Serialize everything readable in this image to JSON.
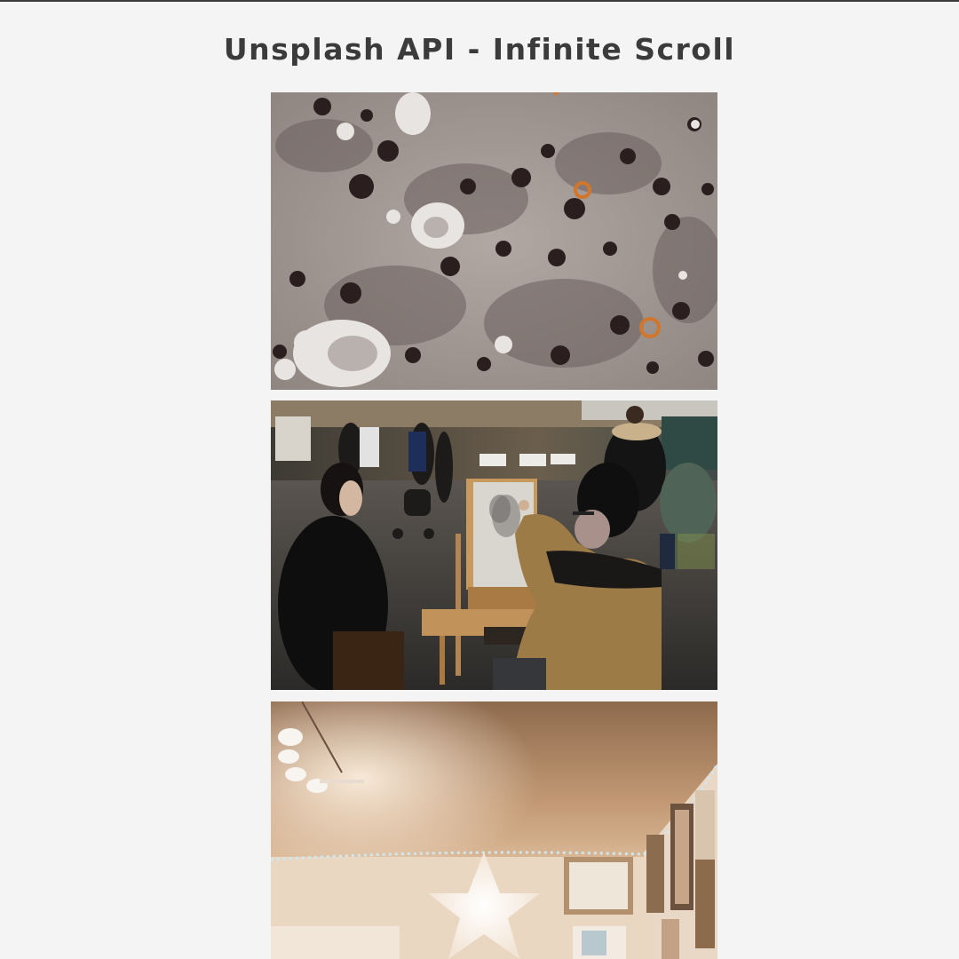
{
  "page": {
    "title": "Unsplash API - Infinite Scroll"
  },
  "photos": [
    {
      "subject": "lichen-texture"
    },
    {
      "subject": "street-artist-drawing-portrait"
    },
    {
      "subject": "warm-room-with-star-lamp-and-framed-pictures"
    }
  ]
}
